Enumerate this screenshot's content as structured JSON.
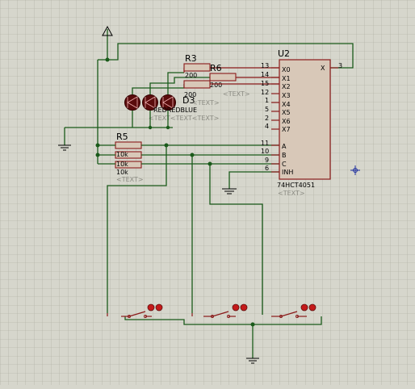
{
  "chip": {
    "ref": "U2",
    "part": "74HCT4051",
    "text_tag": "<TEXT>",
    "left_pins": [
      {
        "num": "13",
        "name": "X0"
      },
      {
        "num": "14",
        "name": "X1"
      },
      {
        "num": "15",
        "name": "X2"
      },
      {
        "num": "12",
        "name": "X3"
      },
      {
        "num": "1",
        "name": "X4"
      },
      {
        "num": "5",
        "name": "X5"
      },
      {
        "num": "2",
        "name": "X6"
      },
      {
        "num": "4",
        "name": "X7"
      }
    ],
    "ctrl_pins": [
      {
        "num": "11",
        "name": "A"
      },
      {
        "num": "10",
        "name": "B"
      },
      {
        "num": "9",
        "name": "C"
      },
      {
        "num": "6",
        "name": "INH"
      }
    ],
    "out_pin": {
      "num": "3",
      "name": "X"
    }
  },
  "resistors": {
    "r3": {
      "ref": "R3",
      "value": "200"
    },
    "r6": {
      "ref": "R6",
      "value": "200"
    },
    "r_mid": {
      "value": "200"
    },
    "r5": {
      "ref": "R5",
      "values": [
        "10k",
        "10k",
        "10k"
      ]
    }
  },
  "leds": {
    "ref": "D3",
    "labels": "REDREDBLUE",
    "text_tags": "<TEXT<TEXT<TEXT>"
  },
  "ghost_text": {
    "r6_tag": "<TEXT>",
    "r3_tag": "<TEXT>",
    "r5_tag": "<TEXT>"
  },
  "symbols": [
    "power-terminal-icon",
    "ground-icon",
    "switch-icon",
    "probe-icon",
    "crosshair-icon"
  ]
}
